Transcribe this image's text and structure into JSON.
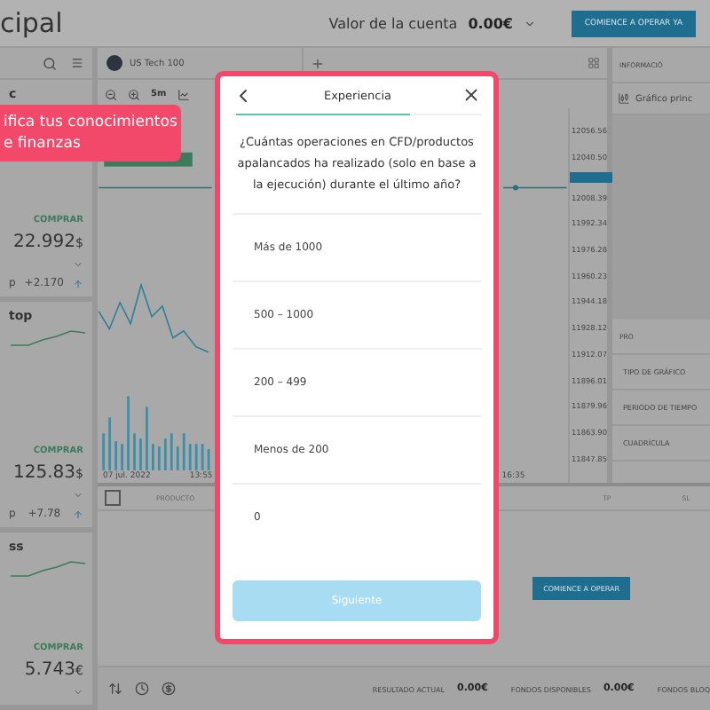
{
  "header": {
    "title": "cipal",
    "account_label": "Valor de la cuenta",
    "account_value": "0.00€",
    "cta": "COMIENCE A OPERAR YA"
  },
  "tooltip": {
    "lines": [
      "ifica tus conocimientos",
      "e finanzas"
    ]
  },
  "watchlist": [
    {
      "name": "c",
      "action": "COMPRAR",
      "price": "22.992",
      "currency": "$",
      "change_label": "p",
      "change": "+2.170"
    },
    {
      "name": "top",
      "action": "COMPRAR",
      "price": "125.83",
      "currency": "$",
      "change_label": "p",
      "change": "+7.78"
    },
    {
      "name": "ss",
      "action": "COMPRAR",
      "price": "5.743",
      "currency": "€"
    }
  ],
  "chart_tab": {
    "label": "US Tech 100"
  },
  "toolbar": {
    "timeframe": "5m"
  },
  "price_axis": [
    "12056.56",
    "12040.50",
    "12008.39",
    "11992.34",
    "11976.28",
    "11960.23",
    "11944.18",
    "11928.12",
    "11912.07",
    "11896.01",
    "11879.96",
    "11863.90",
    "11847.85"
  ],
  "time_axis": [
    "07 jul. 2022",
    "13:55",
    "16:35"
  ],
  "positions": {
    "select_all": {
      "checked": false
    },
    "columns": [
      "PRODUCTO",
      "TP",
      "SL"
    ],
    "cta": "COMIENCE A OPERAR"
  },
  "side_panel": {
    "tab": "INFORMACIÓ",
    "chart_name": "Gráfico princ",
    "section": "PRO",
    "settings": [
      "TIPO DE GRÁFICO",
      "PERIODO DE TIEMPO",
      "CUADRÍCULA"
    ]
  },
  "footer": [
    {
      "label": "RESULTADO ACTUAL",
      "value": "0.00€"
    },
    {
      "label": "FONDOS DISPONIBLES",
      "value": "0.00€"
    },
    {
      "label": "FONDOS BLOQ"
    }
  ],
  "dialog": {
    "title": "Experiencia",
    "question": "¿Cuántas operaciones en CFD/productos apalancados ha realizado (solo en base a la ejecución) durante el último año?",
    "options": [
      {
        "label": "Más de 1000",
        "selected": false
      },
      {
        "label": "500 – 1000",
        "selected": false
      },
      {
        "label": "200 – 499",
        "selected": false
      },
      {
        "label": "Menos de 200",
        "selected": false
      },
      {
        "label": "0",
        "selected": false
      }
    ],
    "next": {
      "label": "Siguiente",
      "disabled": true
    }
  }
}
